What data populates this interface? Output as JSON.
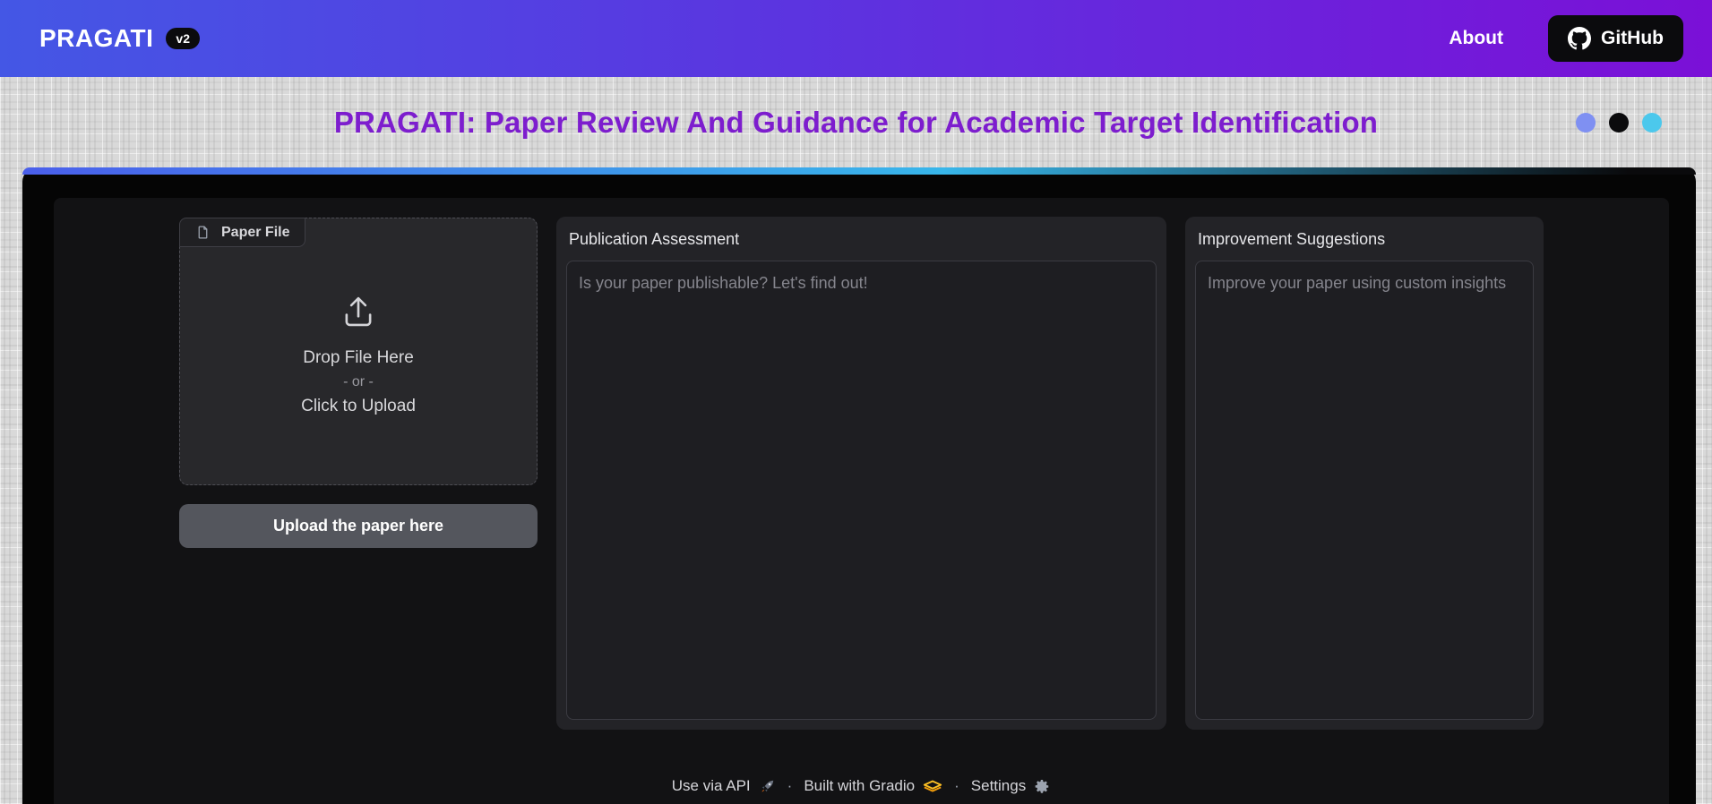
{
  "navbar": {
    "logo": "PRAGATI",
    "version_badge": "v2",
    "about_label": "About",
    "github_label": "GitHub"
  },
  "header": {
    "title": "PRAGATI: Paper Review And Guidance for Academic Target Identification",
    "title_color": "#7d1dce",
    "dots": [
      {
        "name": "dot-blue",
        "color": "#7f90f2"
      },
      {
        "name": "dot-black",
        "color": "#0b0b0d"
      },
      {
        "name": "dot-cyan",
        "color": "#4cc8ec"
      }
    ]
  },
  "upload_panel": {
    "tab_label": "Paper File",
    "drop_line1": "Drop File Here",
    "drop_line2": "- or -",
    "drop_line3": "Click to Upload",
    "button_label": "Upload the paper here"
  },
  "assessment_panel": {
    "label": "Publication Assessment",
    "placeholder": "Is your paper publishable? Let's find out!"
  },
  "suggestions_panel": {
    "label": "Improvement Suggestions",
    "placeholder": "Improve your paper using custom insights"
  },
  "footer": {
    "api_label": "Use via API",
    "sep1": "·",
    "gradio_label": "Built with Gradio",
    "sep2": "·",
    "settings_label": "Settings"
  },
  "icons": {
    "github": "github-octocat",
    "paper_file": "document-outline",
    "upload": "upload-arrow-tray",
    "api": "rocket",
    "gradio": "gradio-layers",
    "settings": "gear"
  },
  "colors": {
    "navbar_gradient_start": "#4457e5",
    "navbar_gradient_end": "#7b10d7",
    "container_bar_blue": "#4a5feb",
    "container_bar_cyan": "#38b6ea",
    "outer_container": "#050505",
    "app_background": "#121214",
    "card_background": "#232327",
    "textarea_background": "#1e1e22",
    "button_background": "#54565d",
    "gradio_logo_orange": "#f59e0b"
  }
}
